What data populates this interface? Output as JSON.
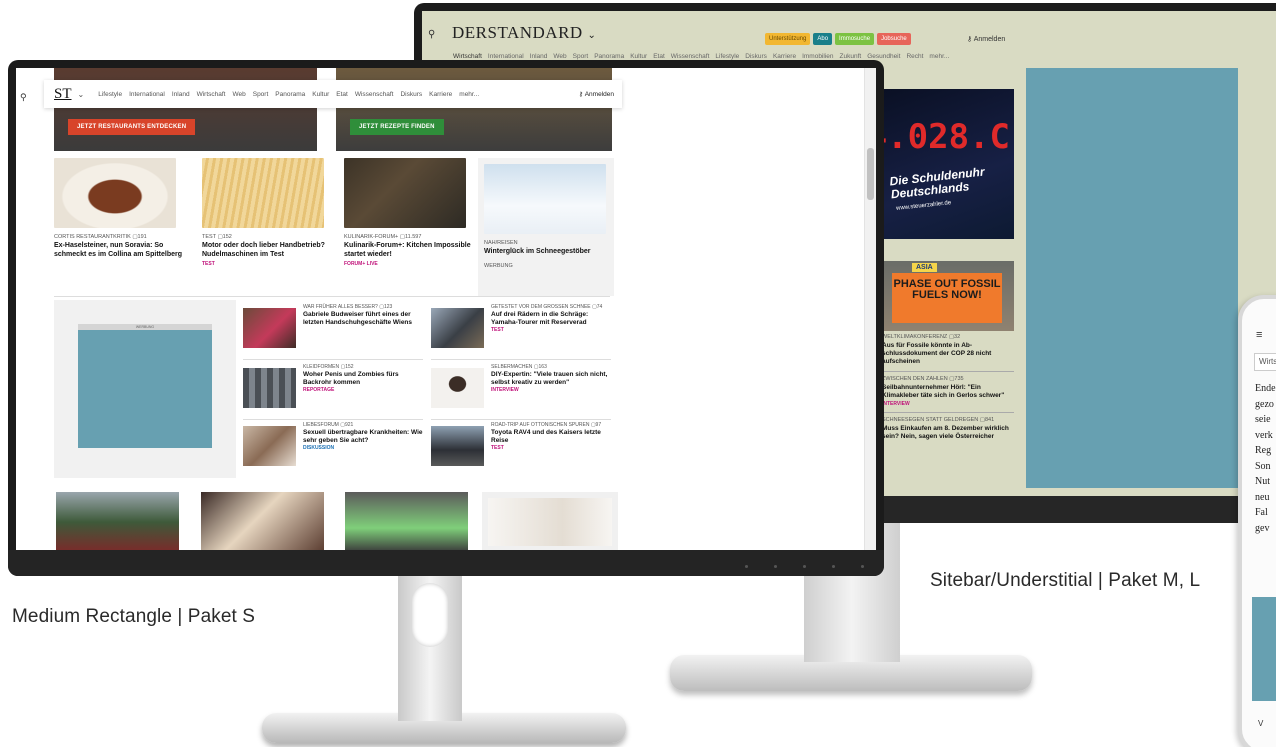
{
  "captions": {
    "front": "Medium Rectangle | Paket S",
    "back": "Sitebar/Understitial | Paket M, L"
  },
  "colors": {
    "ad_placeholder": "#67a0b1",
    "back_bg": "#d9dbc3",
    "tag_pink": "#c0137a",
    "tag_blue": "#1a6fb3"
  },
  "back_site": {
    "search_icon": "search-icon",
    "logo": "DERSTANDARD",
    "logo_chevron": "⌄",
    "badges": [
      {
        "label": "Unterstützung",
        "color": "#f2b731"
      },
      {
        "label": "Abo",
        "color": "#1a7f8a"
      },
      {
        "label": "Immosuche",
        "color": "#7cc242"
      },
      {
        "label": "Jobsuche",
        "color": "#e7655a"
      }
    ],
    "login": "Anmelden",
    "nav": [
      "Wirtschaft",
      "International",
      "Inland",
      "Web",
      "Sport",
      "Panorama",
      "Kultur",
      "Etat",
      "Wissenschaft",
      "Lifestyle",
      "Diskurs",
      "Karriere",
      "Immobilien",
      "Zukunft",
      "Gesundheit",
      "Recht",
      "mehr..."
    ],
    "img1": {
      "led": "4.028.C",
      "label": "Die Schuldenuhr Deutschlands",
      "url": "www.steuerzahler.de"
    },
    "img2": {
      "top": "ASIA",
      "banner": "PHASE OUT FOSSIL FUELS NOW!"
    },
    "articles": [
      {
        "kicker": "WELTKLIMAKONFERENZ ▢32",
        "headline": "Aus für Fossile könnte in Ab-schlussdokument der COP 28 nicht aufscheinen",
        "tag": ""
      },
      {
        "kicker": "ZWISCHEN DEN ZAHLEN ▢735",
        "headline": "Seilbahnunternehmer Hörl: \"Ein Klimakleber täte sich in Gerlos schwer\"",
        "tag": "INTERVIEW"
      },
      {
        "kicker": "SCHNEESEGEN STATT GELDREGEN ▢841",
        "headline": "Muss Einkaufen am 8. Dezember wirklich sein? Nein, sagen viele Österreicher",
        "tag": ""
      }
    ]
  },
  "front_site": {
    "search_icon": "search-icon",
    "logo": "ST",
    "logo_chevron": "⌄",
    "nav": [
      "Lifestyle",
      "International",
      "Inland",
      "Wirtschaft",
      "Web",
      "Sport",
      "Panorama",
      "Kultur",
      "Etat",
      "Wissenschaft",
      "Diskurs",
      "Karriere",
      "mehr..."
    ],
    "login": "Anmelden",
    "heroes": [
      {
        "button": "JETZT RESTAURANTS ENTDECKEN",
        "color": "#d8442a"
      },
      {
        "button": "JETZT REZEPTE FINDEN",
        "color": "#2f8e3a"
      }
    ],
    "cards": [
      {
        "kicker": "CORTIS RESTAURANTKRITIK ▢191",
        "headline": "Ex-Haselsteiner, nun Soravia: So schmeckt es im Collina am Spittelberg",
        "tag": ""
      },
      {
        "kicker": "TEST ▢152",
        "headline": "Motor oder doch lieber Handbetrieb? Nudelmaschinen im Test",
        "tag": "TEST"
      },
      {
        "kicker": "KULINARIK-FORUM+ ▢11.597",
        "headline": "Kulinarik-Forum+: Kitchen Impossible startet wieder!",
        "tag": "FORUM+ LIVE"
      },
      {
        "kicker": "NAH/REISEN",
        "headline": "Winterglück im Schneegestöber",
        "tag": "WERBUNG"
      }
    ],
    "medium_rectangle_label": "WERBUNG",
    "teasers": [
      {
        "kicker": "WAR FRÜHER ALLES BESSER? ▢123",
        "headline": "Gabriele Budweiser führt eines der letzten Handschuhgeschäfte Wiens",
        "tag": ""
      },
      {
        "kicker": "GETESTET VOR DEM GROSSEN SCHNEE ▢74",
        "headline": "Auf drei Rädern in die Schräge: Yamaha-Tourer mit Reserverad",
        "tag": "TEST"
      },
      {
        "kicker": "KLEIDFORMEN ▢152",
        "headline": "Woher Penis und Zombies fürs Backrohr kommen",
        "tag": "REPORTAGE"
      },
      {
        "kicker": "SELBERMACHEN ▢163",
        "headline": "DIY-Expertin: \"Viele trauen sich nicht, selbst kreativ zu werden\"",
        "tag": "INTERVIEW"
      },
      {
        "kicker": "LIEBESFORUM ▢921",
        "headline": "Sexuell übertragbare Krankheiten: Wie sehr geben Sie acht?",
        "tag": "DISKUSSION"
      },
      {
        "kicker": "ROAD-TRIP AUF OTTONISCHEN SPUREN ▢97",
        "headline": "Toyota RAV4 und des Kaisers letzte Reise",
        "tag": "TEST"
      }
    ]
  },
  "phone": {
    "menu_icon": "≡",
    "tab": "Wirts",
    "lines": [
      "Ende",
      "gezo",
      "seie",
      "verk",
      "Reg",
      "Son",
      "Nut",
      "neu",
      "Fal",
      "gev"
    ],
    "footer": "V"
  }
}
